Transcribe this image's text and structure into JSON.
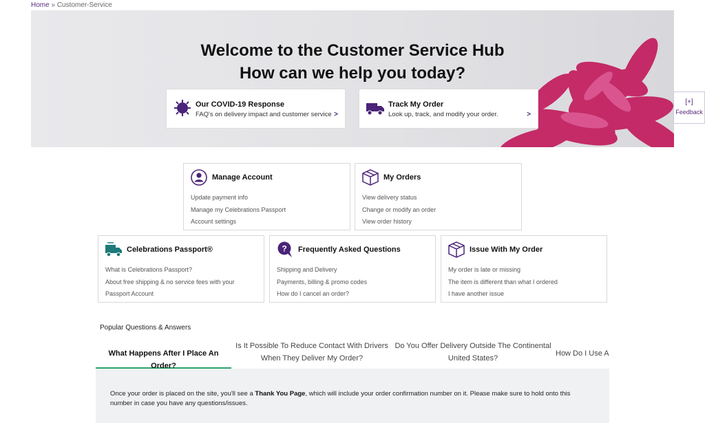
{
  "breadcrumb": {
    "home": "Home",
    "separator": "»",
    "current": "Customer-Service"
  },
  "hero": {
    "title_line1": "Welcome to the Customer Service Hub",
    "title_line2": "How can we help you today?",
    "cards": [
      {
        "title": "Our COVID-19 Response",
        "subtitle": "FAQ's on delivery impact and customer service",
        "icon": "virus-icon",
        "arrow": ">"
      },
      {
        "title": "Track My Order",
        "subtitle": "Look up, track, and modify your order.",
        "icon": "delivery-truck-icon",
        "arrow": ">"
      }
    ]
  },
  "feedback": {
    "plus": "[+]",
    "label": "Feedback"
  },
  "cards": {
    "manage_account": {
      "title": "Manage Account",
      "icon": "user-circle-icon",
      "links": [
        "Update payment info",
        "Manage my Celebrations Passport",
        "Account settings"
      ]
    },
    "my_orders": {
      "title": "My Orders",
      "icon": "box-icon",
      "links": [
        "View delivery status",
        "Change or modify an order",
        "View order history"
      ]
    },
    "passport": {
      "title": "Celebrations Passport®",
      "icon": "passport-truck-icon",
      "links": [
        "What is Celebrations Passport?",
        "About free shipping & no service fees with your Passport Account"
      ]
    },
    "faq": {
      "title": "Frequently Asked Questions",
      "icon": "question-bubble-icon",
      "links": [
        "Shipping and Delivery",
        "Payments, billing & promo codes",
        "How do I cancel an order?"
      ]
    },
    "issue": {
      "title": "Issue With My Order",
      "icon": "box-icon",
      "links": [
        "My order is late or missing",
        "The item is different than what I ordered",
        "I have another issue"
      ]
    }
  },
  "popular": {
    "heading": "Popular Questions & Answers",
    "tabs": [
      "What Happens After I Place An Order?",
      "Is It Possible To Reduce Contact With Drivers When They Deliver My Order?",
      "Do You Offer Delivery Outside The Continental United States?",
      "How Do I Use A"
    ],
    "active_tab": 0,
    "answer_before": "Once your order is placed on the site, you'll see a ",
    "answer_bold": "Thank You Page",
    "answer_after": ", which will include your order confirmation number on it. Please make sure to hold onto this number in case you have any questions/issues."
  },
  "colors": {
    "brand_purple": "#5a2d82",
    "flower_pink": "#c2185b",
    "active_tab_underline": "#2ca56b",
    "passport_teal": "#1f7a7a"
  }
}
